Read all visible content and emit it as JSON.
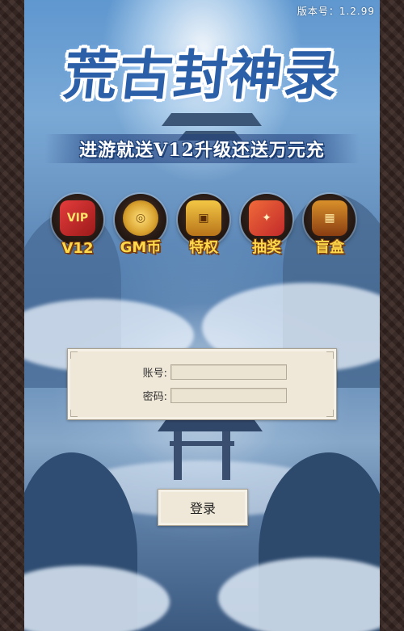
{
  "version_label": "版本号：1.2.99",
  "title": "荒古封神录",
  "slogan": "进游就送V12升级还送万元充",
  "perks": [
    {
      "label": "V12",
      "icon": "vip-card-icon",
      "glyph": "VIP"
    },
    {
      "label": "GM币",
      "icon": "gold-coin-icon",
      "glyph": "◎"
    },
    {
      "label": "特权",
      "icon": "treasure-chest-icon",
      "glyph": "▣"
    },
    {
      "label": "抽奖",
      "icon": "lottery-card-icon",
      "glyph": "✦"
    },
    {
      "label": "盲盒",
      "icon": "mystery-box-icon",
      "glyph": "▦"
    }
  ],
  "login": {
    "account_label": "账号:",
    "account_value": "",
    "password_label": "密码:",
    "password_value": "",
    "submit_label": "登录"
  }
}
